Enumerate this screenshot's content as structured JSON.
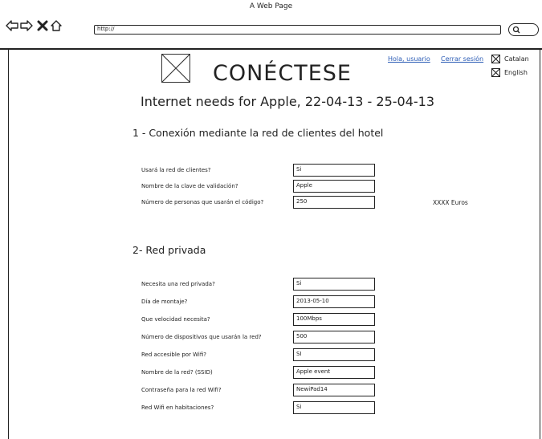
{
  "window": {
    "title": "A Web Page"
  },
  "browser": {
    "url": "http://",
    "back_icon": "back-arrow-icon",
    "forward_icon": "forward-arrow-icon",
    "stop_icon": "close-x-icon",
    "home_icon": "home-icon",
    "search_icon": "search-icon"
  },
  "header": {
    "title": "CONÉCTESE",
    "user_link": "Hola, usuario",
    "logout_link": "Cerrar sesión",
    "languages": [
      "Catalan",
      "English"
    ]
  },
  "event_title": "Internet needs for Apple, 22-04-13 - 25-04-13",
  "section1": {
    "title": "1 - Conexión mediante la red de clientes del hotel",
    "fields": [
      {
        "label": "Usará la red de clientes?",
        "value": "Si"
      },
      {
        "label": "Nombre de la clave de validación?",
        "value": "Apple"
      },
      {
        "label": "Número de personas que usarán el código?",
        "value": "250"
      }
    ],
    "cost": "XXXX Euros"
  },
  "section2": {
    "title": "2- Red privada",
    "fields": [
      {
        "label": "Necesita una red privada?",
        "value": "Si"
      },
      {
        "label": "Día de montaje?",
        "value": "2013-05-10"
      },
      {
        "label": "Que velocidad necesita?",
        "value": "100Mbps"
      },
      {
        "label": "Número de dispositivos que usarán la red?",
        "value": "500"
      },
      {
        "label": "Red accesible por Wifi?",
        "value": "SI"
      },
      {
        "label": "Nombre de la red? (SSID)",
        "value": "Apple event"
      },
      {
        "label": "Contraseña para la red Wifi?",
        "value": "NewiPad14"
      },
      {
        "label": "Red Wifi en habitaciones?",
        "value": "Si"
      }
    ]
  }
}
